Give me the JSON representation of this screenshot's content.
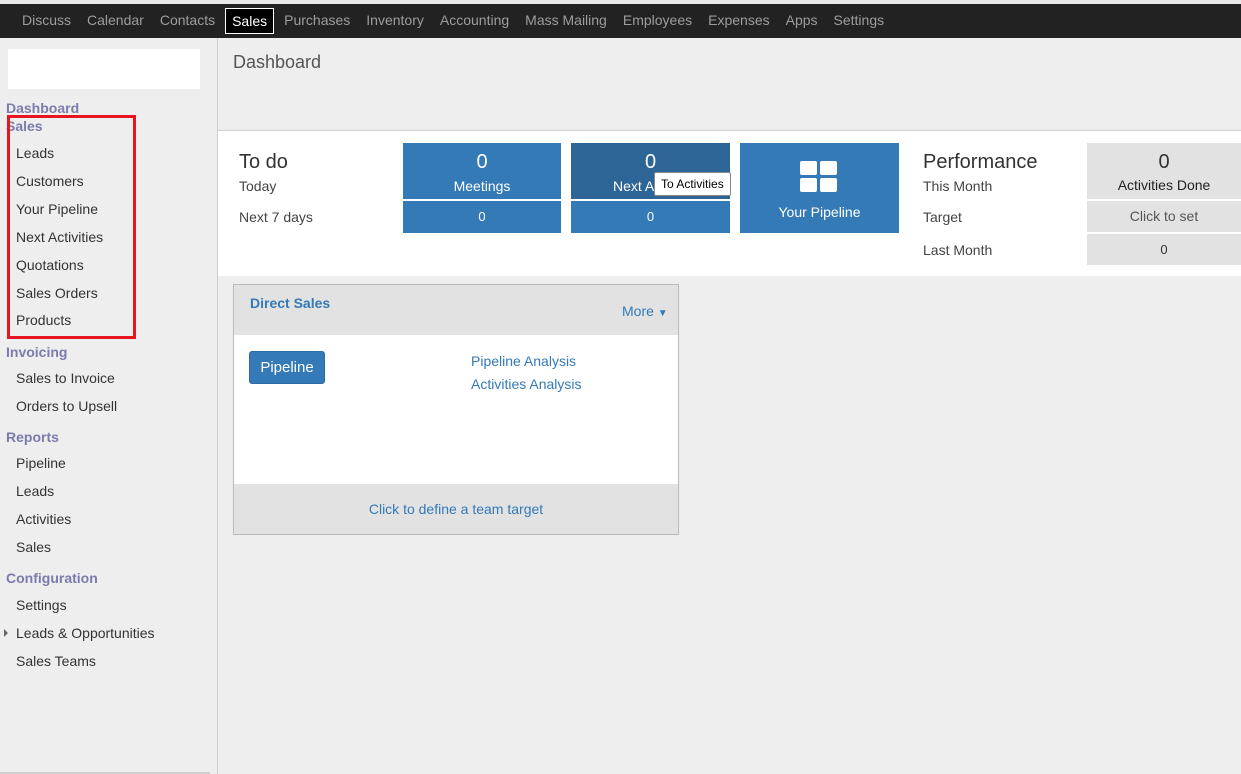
{
  "topbar": {
    "items": [
      "Discuss",
      "Calendar",
      "Contacts",
      "Sales",
      "Purchases",
      "Inventory",
      "Accounting",
      "Mass Mailing",
      "Employees",
      "Expenses",
      "Apps",
      "Settings"
    ],
    "active": "Sales"
  },
  "sidebar": {
    "dashboard": "Dashboard",
    "sales_header": "Sales",
    "sales_items": [
      "Leads",
      "Customers",
      "Your Pipeline",
      "Next Activities",
      "Quotations",
      "Sales Orders",
      "Products"
    ],
    "invoicing_header": "Invoicing",
    "invoicing_items": [
      "Sales to Invoice",
      "Orders to Upsell"
    ],
    "reports_header": "Reports",
    "reports_items": [
      "Pipeline",
      "Leads",
      "Activities",
      "Sales"
    ],
    "configuration_header": "Configuration",
    "configuration_items": [
      "Settings",
      "Leads & Opportunities",
      "Sales Teams"
    ]
  },
  "main": {
    "title": "Dashboard",
    "todo": {
      "title": "To do",
      "today_label": "Today",
      "next7_label": "Next 7 days",
      "meetings": {
        "today": "0",
        "label": "Meetings",
        "next7": "0"
      },
      "next_activities": {
        "today": "0",
        "label": "Next A",
        "next7": "0"
      },
      "pipeline_label": "Your Pipeline",
      "tooltip": "To Activities"
    },
    "performance": {
      "title": "Performance",
      "this_month_label": "This Month",
      "target_label": "Target",
      "last_month_label": "Last Month",
      "activities_done_value": "0",
      "activities_done_label": "Activities Done",
      "target_value": "Click to set",
      "last_month_value": "0"
    },
    "team_card": {
      "title": "Direct Sales",
      "more": "More",
      "pipeline_button": "Pipeline",
      "links": [
        "Pipeline Analysis",
        "Activities Analysis"
      ],
      "footer": "Click to define a team target"
    }
  },
  "colors": {
    "accent": "#337ab7",
    "section_header": "#7c7bad",
    "highlight": "#e8141f",
    "topbar": "#222222"
  }
}
